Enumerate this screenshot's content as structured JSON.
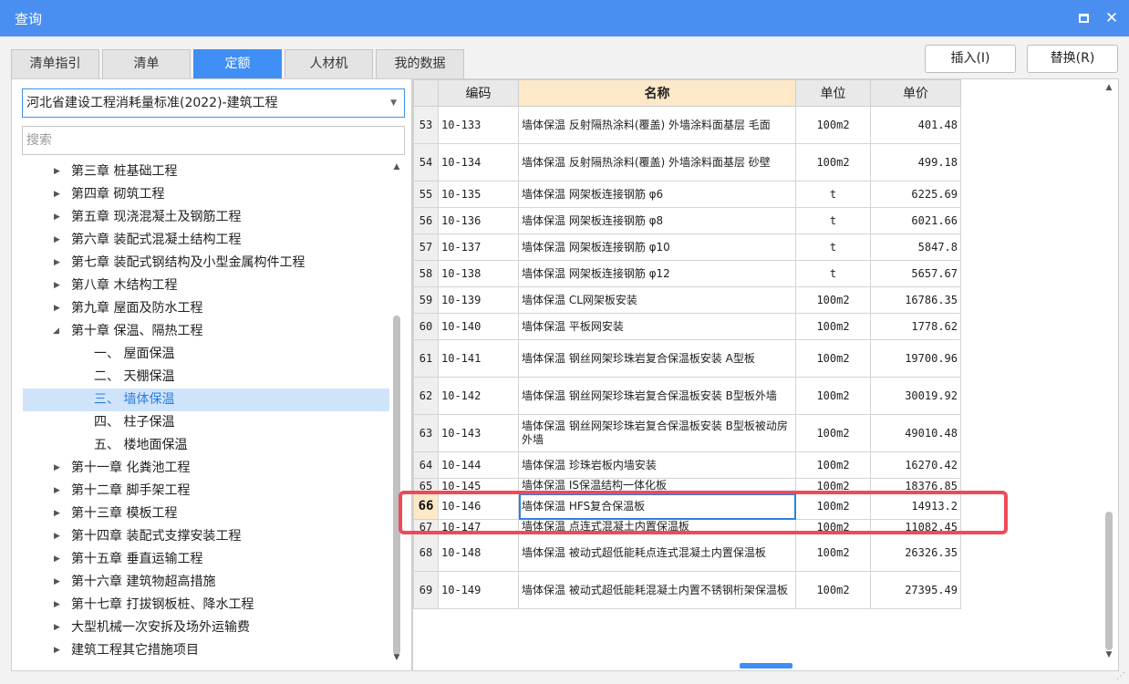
{
  "window": {
    "title": "查询"
  },
  "tabs": [
    {
      "label": "清单指引",
      "active": false
    },
    {
      "label": "清单",
      "active": false
    },
    {
      "label": "定额",
      "active": true
    },
    {
      "label": "人材机",
      "active": false
    },
    {
      "label": "我的数据",
      "active": false
    }
  ],
  "actions": {
    "insert_label": "插入(I)",
    "replace_label": "替换(R)"
  },
  "left": {
    "library_select": "河北省建设工程消耗量标准(2022)-建筑工程",
    "search_placeholder": "搜索",
    "tree": [
      {
        "label": "第三章 桩基础工程",
        "level": 0,
        "expanded": false,
        "selected": false
      },
      {
        "label": "第四章 砌筑工程",
        "level": 0,
        "expanded": false,
        "selected": false
      },
      {
        "label": "第五章 现浇混凝土及钢筋工程",
        "level": 0,
        "expanded": false,
        "selected": false
      },
      {
        "label": "第六章 装配式混凝土结构工程",
        "level": 0,
        "expanded": false,
        "selected": false
      },
      {
        "label": "第七章 装配式钢结构及小型金属构件工程",
        "level": 0,
        "expanded": false,
        "selected": false
      },
      {
        "label": "第八章 木结构工程",
        "level": 0,
        "expanded": false,
        "selected": false
      },
      {
        "label": "第九章 屋面及防水工程",
        "level": 0,
        "expanded": false,
        "selected": false
      },
      {
        "label": "第十章 保温、隔热工程",
        "level": 0,
        "expanded": true,
        "selected": false
      },
      {
        "label": "一、 屋面保温",
        "level": 1,
        "selected": false
      },
      {
        "label": "二、 天棚保温",
        "level": 1,
        "selected": false
      },
      {
        "label": "三、 墙体保温",
        "level": 1,
        "selected": true
      },
      {
        "label": "四、 柱子保温",
        "level": 1,
        "selected": false
      },
      {
        "label": "五、 楼地面保温",
        "level": 1,
        "selected": false
      },
      {
        "label": "第十一章 化粪池工程",
        "level": 0,
        "expanded": false,
        "selected": false
      },
      {
        "label": "第十二章 脚手架工程",
        "level": 0,
        "expanded": false,
        "selected": false
      },
      {
        "label": "第十三章 模板工程",
        "level": 0,
        "expanded": false,
        "selected": false
      },
      {
        "label": "第十四章 装配式支撑安装工程",
        "level": 0,
        "expanded": false,
        "selected": false
      },
      {
        "label": "第十五章 垂直运输工程",
        "level": 0,
        "expanded": false,
        "selected": false
      },
      {
        "label": "第十六章 建筑物超高措施",
        "level": 0,
        "expanded": false,
        "selected": false
      },
      {
        "label": "第十七章 打拔钢板桩、降水工程",
        "level": 0,
        "expanded": false,
        "selected": false
      },
      {
        "label": "大型机械一次安拆及场外运输费",
        "level": 0,
        "expanded": false,
        "selected": false
      },
      {
        "label": "建筑工程其它措施项目",
        "level": 0,
        "expanded": false,
        "selected": false
      }
    ]
  },
  "grid": {
    "columns": {
      "code": "编码",
      "name": "名称",
      "unit": "单位",
      "price": "单价"
    },
    "rows": [
      {
        "num": "53",
        "code": "10-133",
        "name": "墙体保温 反射隔热涂料(覆盖) 外墙涂料面基层 毛面",
        "unit": "100m2",
        "price": "401.48",
        "tall": true
      },
      {
        "num": "54",
        "code": "10-134",
        "name": "墙体保温 反射隔热涂料(覆盖) 外墙涂料面基层 砂壁",
        "unit": "100m2",
        "price": "499.18",
        "tall": true
      },
      {
        "num": "55",
        "code": "10-135",
        "name": "墙体保温 网架板连接钢筋 φ6",
        "unit": "t",
        "price": "6225.69"
      },
      {
        "num": "56",
        "code": "10-136",
        "name": "墙体保温 网架板连接钢筋 φ8",
        "unit": "t",
        "price": "6021.66"
      },
      {
        "num": "57",
        "code": "10-137",
        "name": "墙体保温 网架板连接钢筋 φ10",
        "unit": "t",
        "price": "5847.8"
      },
      {
        "num": "58",
        "code": "10-138",
        "name": "墙体保温 网架板连接钢筋 φ12",
        "unit": "t",
        "price": "5657.67"
      },
      {
        "num": "59",
        "code": "10-139",
        "name": "墙体保温 CL网架板安装",
        "unit": "100m2",
        "price": "16786.35"
      },
      {
        "num": "60",
        "code": "10-140",
        "name": "墙体保温 平板网安装",
        "unit": "100m2",
        "price": "1778.62"
      },
      {
        "num": "61",
        "code": "10-141",
        "name": "墙体保温 钢丝网架珍珠岩复合保温板安装 A型板",
        "unit": "100m2",
        "price": "19700.96",
        "tall": true
      },
      {
        "num": "62",
        "code": "10-142",
        "name": "墙体保温 钢丝网架珍珠岩复合保温板安装 B型板外墙",
        "unit": "100m2",
        "price": "30019.92",
        "tall": true
      },
      {
        "num": "63",
        "code": "10-143",
        "name": "墙体保温 钢丝网架珍珠岩复合保温板安装 B型板被动房外墙",
        "unit": "100m2",
        "price": "49010.48",
        "tall": true
      },
      {
        "num": "64",
        "code": "10-144",
        "name": "墙体保温 珍珠岩板内墙安装",
        "unit": "100m2",
        "price": "16270.42"
      },
      {
        "num": "65",
        "code": "10-145",
        "name": "墙体保温 IS保温结构一体化板",
        "unit": "100m2",
        "price": "18376.85",
        "partial": true
      },
      {
        "num": "66",
        "code": "10-146",
        "name": "墙体保温 HFS复合保温板",
        "unit": "100m2",
        "price": "14913.2",
        "current": true
      },
      {
        "num": "67",
        "code": "10-147",
        "name": "墙体保温 点连式混凝土内置保温板",
        "unit": "100m2",
        "price": "11082.45",
        "partial": true
      },
      {
        "num": "68",
        "code": "10-148",
        "name": "墙体保温 被动式超低能耗点连式混凝土内置保温板",
        "unit": "100m2",
        "price": "26326.35",
        "tall": true
      },
      {
        "num": "69",
        "code": "10-149",
        "name": "墙体保温 被动式超低能耗混凝土内置不锈钢桁架保温板",
        "unit": "100m2",
        "price": "27395.49",
        "tall": true
      }
    ]
  },
  "colors": {
    "accent": "#3f8ef3",
    "titlebar": "#4a8ff0",
    "highlight_box": "#ee4a5a",
    "header_highlight": "#fde8c8",
    "tree_selected": "#cfe4fb"
  }
}
